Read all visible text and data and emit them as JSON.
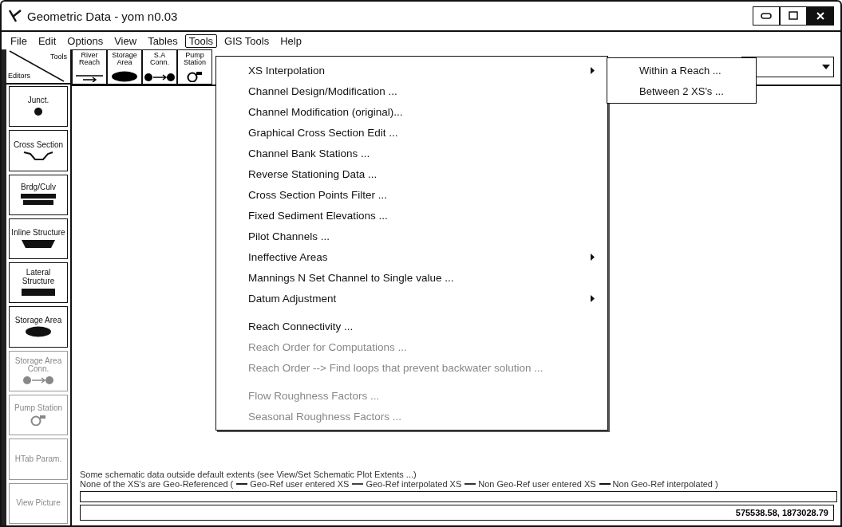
{
  "window": {
    "title": "Geometric Data - yom n0.03"
  },
  "menubar": [
    {
      "label": "File",
      "selected": false
    },
    {
      "label": "Edit",
      "selected": false
    },
    {
      "label": "Options",
      "selected": false
    },
    {
      "label": "View",
      "selected": false
    },
    {
      "label": "Tables",
      "selected": false
    },
    {
      "label": "Tools",
      "selected": true
    },
    {
      "label": "GIS Tools",
      "selected": false
    },
    {
      "label": "Help",
      "selected": false
    }
  ],
  "corner": {
    "tools": "Tools",
    "editors": "Editors"
  },
  "toolbar": [
    {
      "label": "River Reach",
      "kind": "arrow"
    },
    {
      "label": "Storage Area",
      "kind": "blob"
    },
    {
      "label": "S.A Conn.",
      "kind": "connector"
    },
    {
      "label": "Pump Station",
      "kind": "pump"
    }
  ],
  "editors": [
    {
      "label": "Junct.",
      "kind": "junction",
      "disabled": false
    },
    {
      "label": "Cross Section",
      "kind": "section",
      "disabled": false
    },
    {
      "label": "Brdg/Culv",
      "kind": "bridge",
      "disabled": false
    },
    {
      "label": "Inline Structure",
      "kind": "inline",
      "disabled": false
    },
    {
      "label": "Lateral Structure",
      "kind": "lateral",
      "disabled": false
    },
    {
      "label": "Storage Area",
      "kind": "blob",
      "disabled": false
    },
    {
      "label": "Storage Area Conn.",
      "kind": "connector",
      "disabled": true
    },
    {
      "label": "Pump Station",
      "kind": "pump",
      "disabled": true
    },
    {
      "label": "HTab Param.",
      "kind": "plain",
      "disabled": true
    },
    {
      "label": "View Picture",
      "kind": "plain",
      "disabled": true
    }
  ],
  "tools_menu": [
    {
      "items": [
        {
          "label": "XS Interpolation",
          "submenu": true,
          "disabled": false
        },
        {
          "label": "Channel Design/Modification ...",
          "submenu": false,
          "disabled": false
        },
        {
          "label": "Channel Modification (original)...",
          "submenu": false,
          "disabled": false
        },
        {
          "label": "Graphical Cross Section Edit ...",
          "submenu": false,
          "disabled": false
        },
        {
          "label": "Channel Bank Stations ...",
          "submenu": false,
          "disabled": false
        },
        {
          "label": "Reverse Stationing Data ...",
          "submenu": false,
          "disabled": false
        },
        {
          "label": "Cross Section Points Filter ...",
          "submenu": false,
          "disabled": false
        },
        {
          "label": "Fixed Sediment Elevations ...",
          "submenu": false,
          "disabled": false
        },
        {
          "label": "Pilot Channels ...",
          "submenu": false,
          "disabled": false
        },
        {
          "label": "Ineffective Areas",
          "submenu": true,
          "disabled": false
        },
        {
          "label": "Mannings N Set Channel to Single value ...",
          "submenu": false,
          "disabled": false
        },
        {
          "label": "Datum Adjustment",
          "submenu": true,
          "disabled": false
        }
      ]
    },
    {
      "items": [
        {
          "label": "Reach Connectivity ...",
          "submenu": false,
          "disabled": false
        },
        {
          "label": "Reach Order for Computations ...",
          "submenu": false,
          "disabled": true
        },
        {
          "label": "Reach Order --> Find loops that prevent backwater solution ...",
          "submenu": false,
          "disabled": true
        }
      ]
    },
    {
      "items": [
        {
          "label": "Flow Roughness Factors ...",
          "submenu": false,
          "disabled": true
        },
        {
          "label": "Seasonal Roughness Factors ...",
          "submenu": false,
          "disabled": true
        }
      ]
    }
  ],
  "submenu": [
    "Within a Reach ...",
    "Between 2 XS's ..."
  ],
  "notes": {
    "extents": "Some schematic data outside default extents (see View/Set Schematic Plot Extents ...)",
    "georef": "None of the XS's are Geo-Referenced (",
    "legend": [
      {
        "label": "Geo-Ref user entered XS",
        "color": "#222222"
      },
      {
        "label": "Geo-Ref interpolated XS",
        "color": "#444444"
      },
      {
        "label": "Non Geo-Ref user entered XS",
        "color": "#333333"
      },
      {
        "label": "Non Geo-Ref interpolated )",
        "color": "#111111"
      }
    ]
  },
  "status_bar": {
    "coordinates": "575538.58, 1873028.79"
  }
}
